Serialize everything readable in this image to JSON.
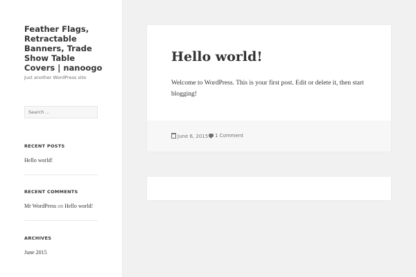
{
  "site": {
    "title": "Feather Flags, Retractable Banners, Trade Show Table Covers | nanoogo",
    "description": "Just another WordPress site"
  },
  "search": {
    "placeholder": "Search …"
  },
  "widgets": {
    "recent_posts": {
      "title": "RECENT POSTS",
      "items": [
        "Hello world!"
      ]
    },
    "recent_comments": {
      "title": "RECENT COMMENTS",
      "author": "Mr WordPress",
      "on": "on",
      "post": "Hello world!"
    },
    "archives": {
      "title": "ARCHIVES",
      "items": [
        "June 2015"
      ]
    }
  },
  "post": {
    "title": "Hello world!",
    "content": "Welcome to WordPress. This is your first post. Edit or delete it, then start blogging!",
    "date": "June 6, 2015",
    "comments": "1 Comment"
  },
  "icons": {
    "date": "calendar-icon",
    "comments": "comment-bubble-icon"
  },
  "colors": {
    "background": "#f1f1f1",
    "panel": "#ffffff",
    "footer": "#f7f7f7",
    "text": "#333333",
    "muted": "#707070"
  }
}
